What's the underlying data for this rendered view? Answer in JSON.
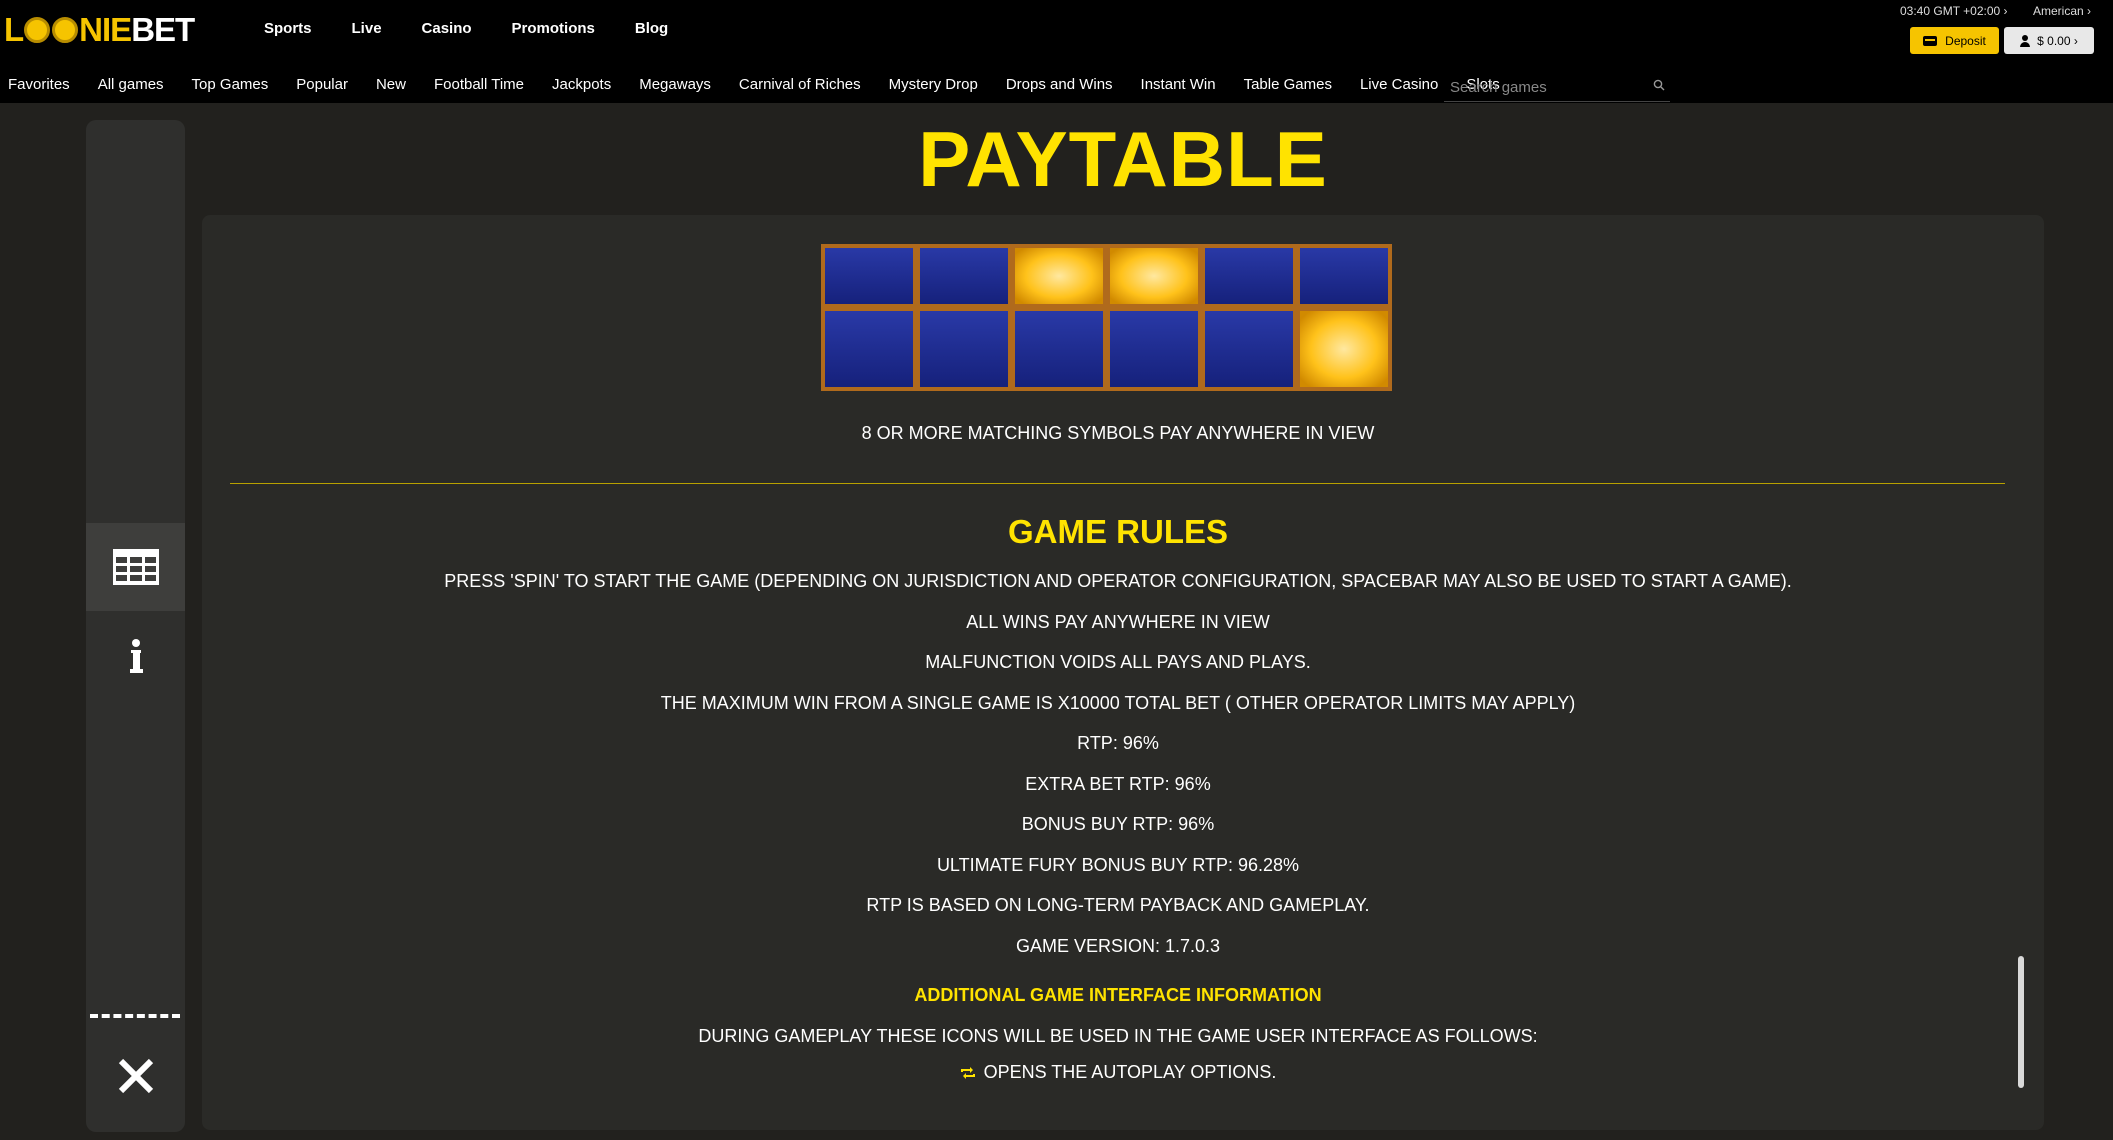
{
  "brand": {
    "logo_text_start": "L",
    "logo_text_mid": "NIE",
    "logo_text_end": "BET",
    "accent": "#f6c400"
  },
  "header": {
    "nav": [
      "Sports",
      "Live",
      "Casino",
      "Promotions",
      "Blog"
    ],
    "clock": "03:40 GMT +02:00 ›",
    "language": "American ›",
    "deposit_label": "Deposit",
    "balance_label": "$ 0.00 ›"
  },
  "categories": [
    "Favorites",
    "All games",
    "Top Games",
    "Popular",
    "New",
    "Football Time",
    "Jackpots",
    "Megaways",
    "Carnival of Riches",
    "Mystery Drop",
    "Drops and Wins",
    "Instant Win",
    "Table Games",
    "Live Casino",
    "Slots"
  ],
  "search": {
    "placeholder": "Search games"
  },
  "side_menu": {
    "items": [
      "paytable-grid-icon",
      "info-icon",
      "close-icon"
    ]
  },
  "paytable": {
    "title": "PAYTABLE",
    "pay_anywhere": "8 OR MORE MATCHING SYMBOLS PAY ANYWHERE IN VIEW",
    "game_rules_title": "GAME RULES",
    "rules": [
      "PRESS 'SPIN' TO START THE GAME (DEPENDING ON JURISDICTION AND OPERATOR CONFIGURATION, SPACEBAR MAY ALSO BE USED TO START A GAME).",
      "ALL WINS PAY ANYWHERE IN VIEW",
      "MALFUNCTION VOIDS ALL PAYS AND PLAYS.",
      "THE MAXIMUM WIN FROM A SINGLE GAME IS X10000 TOTAL BET ( OTHER OPERATOR LIMITS MAY APPLY)",
      "RTP: 96%",
      "EXTRA BET RTP: 96%",
      "BONUS BUY RTP: 96%",
      "ULTIMATE FURY BONUS BUY RTP: 96.28%",
      "RTP IS BASED ON LONG-TERM PAYBACK AND GAMEPLAY.",
      "GAME VERSION: 1.7.0.3"
    ],
    "additional_title": "ADDITIONAL GAME INTERFACE INFORMATION",
    "during_text": "DURING GAMEPLAY THESE ICONS WILL BE USED IN THE GAME USER INTERFACE AS FOLLOWS:",
    "autoplay_text": "OPENS THE AUTOPLAY OPTIONS."
  },
  "colors": {
    "title_yellow": "#ffe300",
    "tile_blue": "#1a2a8c",
    "tile_gold": "#ffc21a"
  }
}
